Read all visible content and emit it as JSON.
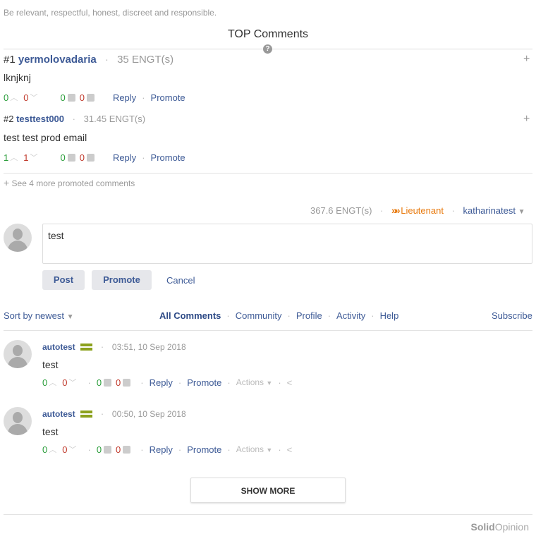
{
  "guidelines": "Be relevant, respectful, honest, discreet and responsible.",
  "top_comments": {
    "title": "TOP Comments",
    "items": [
      {
        "rank": "#1",
        "user": "yermolovadaria",
        "amount": "35 ENGT(s)",
        "text": "lknjknj",
        "up": "0",
        "down": "0",
        "likes": "0",
        "dislikes": "0",
        "reply": "Reply",
        "promote": "Promote"
      },
      {
        "rank": "#2",
        "user": "testtest000",
        "amount": "31.45 ENGT(s)",
        "text": "test test prod email",
        "up": "1",
        "down": "1",
        "likes": "0",
        "dislikes": "0",
        "reply": "Reply",
        "promote": "Promote"
      }
    ],
    "more_promoted": "See 4 more promoted comments"
  },
  "account": {
    "balance": "367.6 ENGT(s)",
    "rank": "Lieutenant",
    "username": "katharinatest"
  },
  "composer": {
    "value": "test",
    "post": "Post",
    "promote": "Promote",
    "cancel": "Cancel"
  },
  "toolbar": {
    "sort": "Sort by newest",
    "tabs": [
      "All Comments",
      "Community",
      "Profile",
      "Activity",
      "Help"
    ],
    "subscribe": "Subscribe"
  },
  "comments": [
    {
      "user": "autotest",
      "time": "03:51, 10 Sep 2018",
      "text": "test",
      "up": "0",
      "down": "0",
      "likes": "0",
      "dislikes": "0",
      "reply": "Reply",
      "promote": "Promote",
      "actions": "Actions"
    },
    {
      "user": "autotest",
      "time": "00:50, 10 Sep 2018",
      "text": "test",
      "up": "0",
      "down": "0",
      "likes": "0",
      "dislikes": "0",
      "reply": "Reply",
      "promote": "Promote",
      "actions": "Actions"
    }
  ],
  "show_more": "SHOW MORE",
  "brand": {
    "solid": "Solid",
    "opinion": "Opinion"
  },
  "colors": {
    "link": "#3d5a96",
    "accent_orange": "#e8790c",
    "vote_green": "#2a9d3a",
    "vote_red": "#c0392b",
    "badge_green": "#8ca11e"
  },
  "icons": [
    "help-icon",
    "plus-icon",
    "chevron-up-icon",
    "chevron-down-icon",
    "thumbs-up-icon",
    "thumbs-down-icon",
    "rank-chevrons-icon",
    "avatar-icon",
    "share-icon"
  ]
}
